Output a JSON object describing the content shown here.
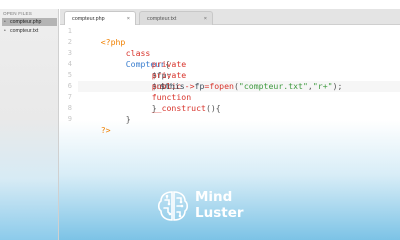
{
  "sidebar": {
    "header": "OPEN FILES",
    "files": [
      {
        "name": "compteur.php",
        "active": true
      },
      {
        "name": "compteur.txt",
        "active": false
      }
    ]
  },
  "tabs": [
    {
      "label": "compteur.php",
      "close": "×",
      "active": true
    },
    {
      "label": "compteur.txt",
      "close": "×",
      "active": false
    }
  ],
  "editor": {
    "line_numbers": [
      "1",
      "2",
      "3",
      "4",
      "5",
      "6",
      "7",
      "8",
      "9"
    ],
    "lines": {
      "l1": {
        "tag": "<?php"
      },
      "l2": {
        "kw": "class",
        "name": "Compteur",
        "brace": "{"
      },
      "l3": {
        "kw": "private",
        "var": "$fp;"
      },
      "l4": {
        "kw": "private",
        "var": "$nbr;"
      },
      "l5": {
        "kw1": "public",
        "kw2": "function",
        "name": "__construct",
        "paren": "(){"
      },
      "l6": {
        "this": "$this",
        "arrow": "->",
        "prop": "fp",
        "eq": "=",
        "func": "fopen",
        "open": "(",
        "arg1": "\"compteur.txt\"",
        "comma": ",",
        "arg2": "\"r+\"",
        "close": ");"
      },
      "l7": {
        "brace": "}"
      },
      "l8": {
        "brace": "}"
      },
      "l9": {
        "tag": "?>"
      }
    }
  },
  "logo": {
    "line1": "Mind",
    "line2": "Luster",
    "icon": "brain-icon"
  }
}
